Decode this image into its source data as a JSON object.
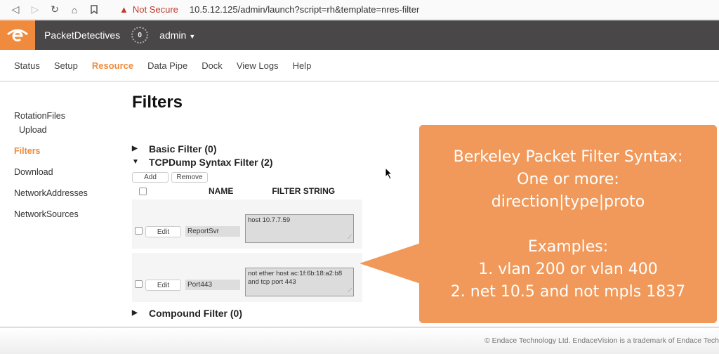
{
  "browser": {
    "security_label": "Not Secure",
    "url": "10.5.12.125/admin/launch?script=rh&template=nres-filter"
  },
  "header": {
    "brand": "PacketDetectives",
    "notification_count": "0",
    "user": "admin",
    "accent_color": "#f08a3c"
  },
  "topnav": {
    "tabs": [
      {
        "label": "Status"
      },
      {
        "label": "Setup"
      },
      {
        "label": "Resource",
        "active": true
      },
      {
        "label": "Data Pipe"
      },
      {
        "label": "Dock"
      },
      {
        "label": "View Logs"
      },
      {
        "label": "Help"
      }
    ]
  },
  "sidebar": {
    "items": [
      {
        "label": "RotationFiles"
      },
      {
        "label": "Upload"
      },
      {
        "label": "Filters",
        "active": true
      },
      {
        "label": "Download"
      },
      {
        "label": "NetworkAddresses"
      },
      {
        "label": "NetworkSources"
      }
    ]
  },
  "main": {
    "title": "Filters",
    "sections": {
      "basic": "Basic Filter (0)",
      "tcpdump": "TCPDump Syntax Filter (2)",
      "compound": "Compound Filter (0)"
    },
    "buttons": {
      "add": "Add",
      "remove": "Remove",
      "edit": "Edit"
    },
    "columns": {
      "name": "NAME",
      "filter_string": "FILTER STRING"
    },
    "rows": [
      {
        "name": "ReportSvr",
        "filter": "host 10.7.7.59"
      },
      {
        "name": "Port443",
        "filter": "not ether host ac:1f:6b:18:a2:b8\nand tcp port 443"
      }
    ]
  },
  "callout": {
    "lines": [
      "Berkeley Packet Filter Syntax:",
      "One or more:",
      "direction|type|proto",
      "",
      "Examples:",
      "1. vlan 200 or vlan 400",
      "2. net 10.5 and not mpls 1837"
    ],
    "color": "#f0995a"
  },
  "footer": {
    "copyright": "© Endace Technology Ltd. EndaceVision is a trademark of Endace Tech"
  }
}
